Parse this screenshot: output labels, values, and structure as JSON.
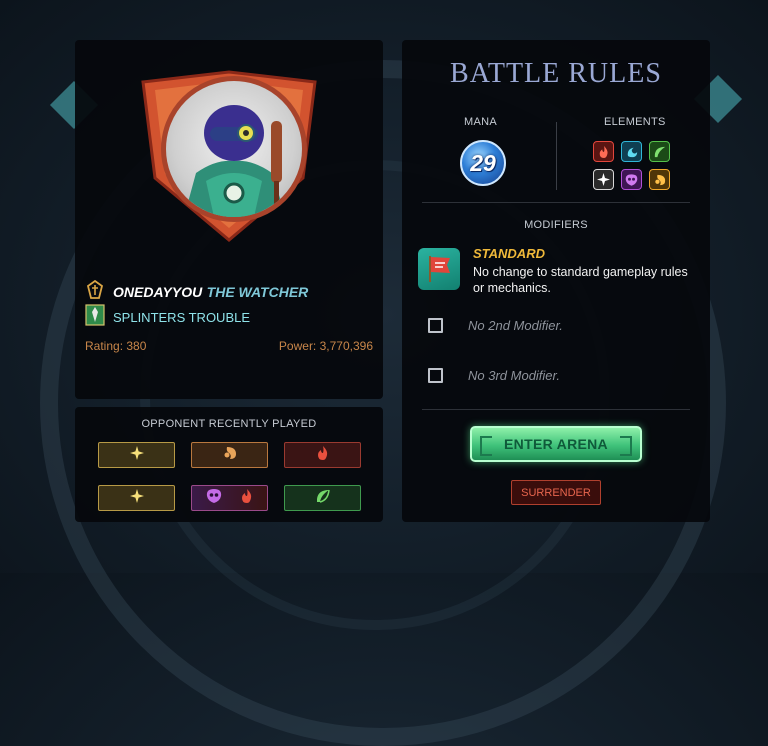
{
  "player": {
    "name": "ONEDAYYOU",
    "title": "THE WATCHER",
    "guild": "SPLINTERS TROUBLE",
    "rating_text": "Rating: 380",
    "power_text": "Power: 3,770,396"
  },
  "opponent": {
    "heading": "OPPONENT RECENTLY PLAYED",
    "recent": [
      [
        "life-icon"
      ],
      [
        "earth-icon"
      ],
      [
        "fire-icon"
      ],
      [
        "life-icon"
      ],
      [
        "death-icon",
        "fire-icon"
      ],
      [
        "water-icon"
      ]
    ]
  },
  "rules": {
    "title": "BATTLE RULES",
    "mana_label": "MANA",
    "mana": "29",
    "elements_label": "ELEMENTS",
    "elements": [
      "fire-icon",
      "water-icon",
      "earth-icon",
      "life-icon",
      "death-icon",
      "dragon-icon"
    ],
    "modifiers_label": "MODIFIERS",
    "modifier_name": "STANDARD",
    "modifier_desc": "No change to standard gameplay rules or mechanics.",
    "mod2": "No 2nd Modifier.",
    "mod3": "No 3rd Modifier."
  },
  "actions": {
    "enter": "ENTER ARENA",
    "surrender": "SURRENDER"
  },
  "colors": {
    "fire": "#e2463c",
    "water": "#2fb6d8",
    "earth": "#55c24a",
    "life": "#f3d56b",
    "death": "#b14fd6",
    "dragon": "#f0a82a",
    "accent_green": "#3fc27a",
    "surrender_red": "#e8664e"
  }
}
